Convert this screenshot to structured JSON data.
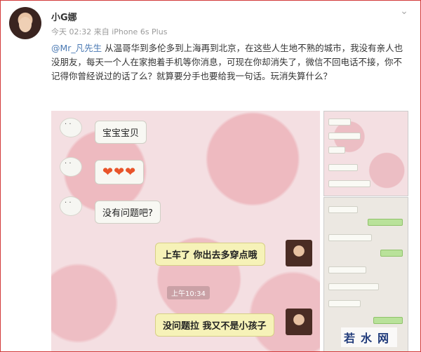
{
  "header": {
    "username": "小G娜",
    "meta": "今天 02:32 来自 iPhone 6s Plus"
  },
  "post": {
    "mention": "@Mr_凡先生",
    "text": " 从温哥华到多伦多到上海再到北京，在这些人生地不熟的城市，我没有亲人也没朋友，每天一个人在家抱着手机等你消息，可现在你却消失了，微信不回电话不接，你不记得你曾经说过的话了么？就算要分手也要给我一句话。玩消失算什么？"
  },
  "chat": {
    "messages": [
      {
        "side": "left",
        "text": "宝宝宝贝"
      },
      {
        "side": "left",
        "text": "❤❤❤"
      },
      {
        "side": "left",
        "text": "没有问题吧?"
      },
      {
        "side": "right",
        "text": "上车了 你出去多穿点哦"
      },
      {
        "side": "right",
        "text": "没问题拉 我又不是小孩子"
      }
    ],
    "timestamp": "上午10:34"
  },
  "icons": {
    "chevron": "chevron-down-icon"
  },
  "watermark": "若水网"
}
